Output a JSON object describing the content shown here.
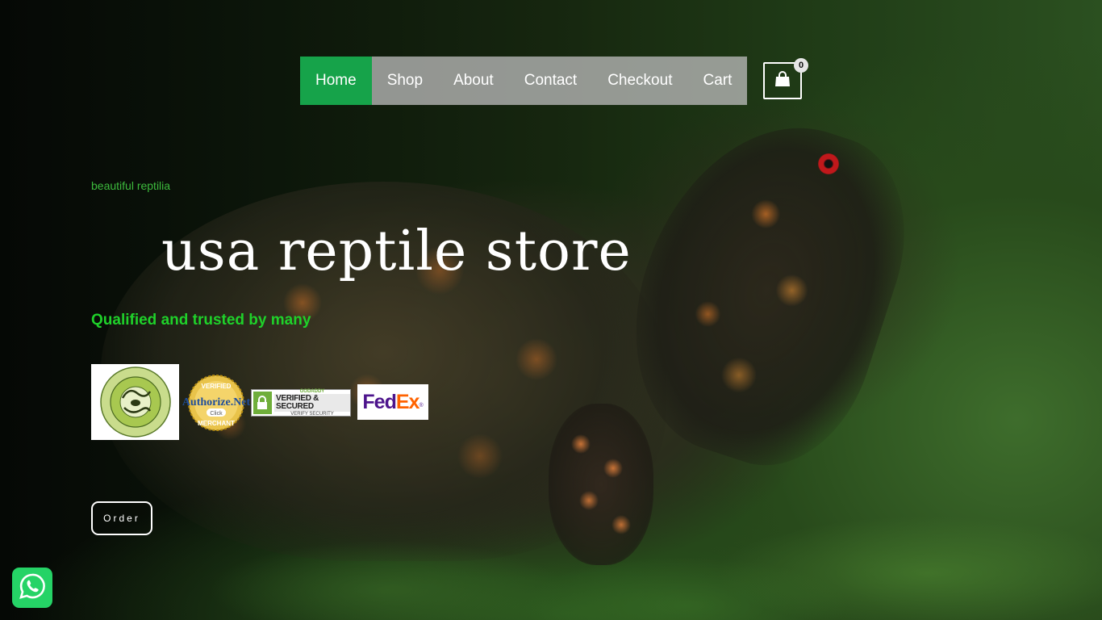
{
  "nav": {
    "items": [
      {
        "label": "Home",
        "active": true
      },
      {
        "label": "Shop",
        "active": false
      },
      {
        "label": "About",
        "active": false
      },
      {
        "label": "Contact",
        "active": false
      },
      {
        "label": "Checkout",
        "active": false
      },
      {
        "label": "Cart",
        "active": false
      }
    ],
    "cart_icon": "shopping-bag-icon",
    "cart_count": "0"
  },
  "hero": {
    "tagline": "beautiful reptilia",
    "title": "usa reptile store",
    "subtitle": "Qualified and trusted by many",
    "cta_label": "Order"
  },
  "badges": {
    "authorize": {
      "top": "VERIFIED",
      "main": "Authorize.Net",
      "click": "Click",
      "bottom": "MERCHANT"
    },
    "godaddy": {
      "top": "GODADDY",
      "main": "VERIFIED & SECURED",
      "bottom": "VERIFY SECURITY"
    },
    "fedex": {
      "fed": "Fed",
      "ex": "Ex",
      "reg": "®"
    }
  },
  "colors": {
    "accent_green": "#16a34a",
    "tagline_green": "#3dbb3d",
    "subtitle_green": "#1fd12a",
    "whatsapp_green": "#25d366",
    "nav_background": "#b9b9b9"
  },
  "floating": {
    "whatsapp_icon": "whatsapp-icon"
  }
}
